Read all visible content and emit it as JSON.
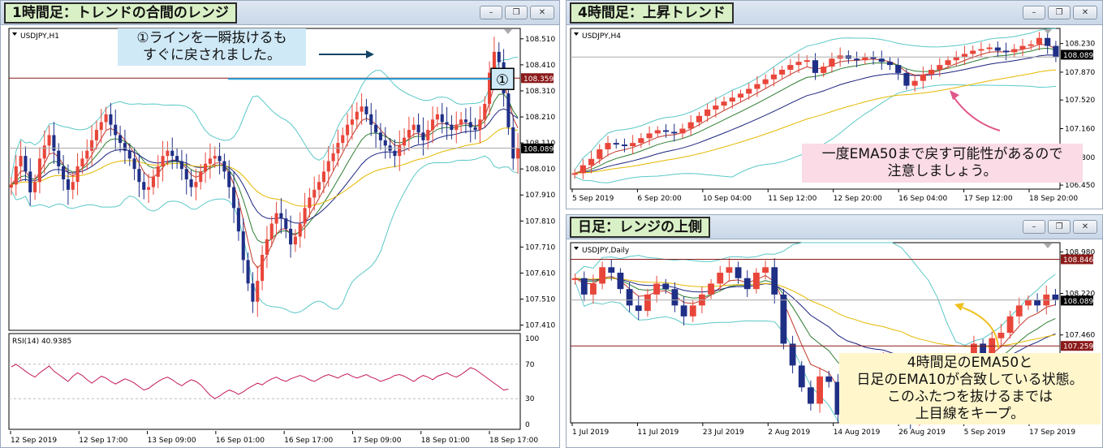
{
  "windows": {
    "h1": {
      "title": "1時間足：トレンドの合間のレンジ",
      "symbol_label": "USDJPY,H1",
      "price_levels": [
        "108.510",
        "108.410",
        "108.310",
        "108.210",
        "108.110",
        "108.010",
        "107.910",
        "107.810",
        "107.710",
        "107.610",
        "107.510",
        "107.410"
      ],
      "price_tags": [
        {
          "text": "108.359",
          "kind": "line"
        },
        {
          "text": "108.089",
          "kind": "current"
        }
      ],
      "marker": "①",
      "rsi_label": "RSI(14) 40.9385",
      "rsi_levels": [
        "100",
        "70",
        "30",
        "0"
      ],
      "time_labels": [
        "12 Sep 2019",
        "12 Sep 17:00",
        "13 Sep 09:00",
        "16 Sep 01:00",
        "16 Sep 17:00",
        "17 Sep 09:00",
        "18 Sep 01:00",
        "18 Sep 17:00"
      ],
      "annotation": [
        "①ラインを一瞬抜けるも",
        "すぐに戻されました。"
      ]
    },
    "h4": {
      "title": "4時間足：上昇トレンド",
      "symbol_label": "USDJPY,H4",
      "price_levels": [
        "108.230",
        "107.870",
        "107.520",
        "107.160",
        "106.800",
        "106.450"
      ],
      "price_tags": [
        {
          "text": "108.089",
          "kind": "current"
        }
      ],
      "time_labels": [
        "5 Sep 2019",
        "6 Sep 20:00",
        "10 Sep 04:00",
        "11 Sep 12:00",
        "12 Sep 20:00",
        "16 Sep 04:00",
        "17 Sep 12:00",
        "18 Sep 20:00"
      ],
      "annotation": [
        "一度EMA50まで戻す可能性があるので",
        "注意しましょう。"
      ]
    },
    "daily": {
      "title": "日足：レンジの上側",
      "symbol_label": "USDJPY,Daily",
      "price_levels": [
        "108.980",
        "108.220",
        "107.460",
        "106.680"
      ],
      "price_tags": [
        {
          "text": "108.846",
          "kind": "line"
        },
        {
          "text": "108.089",
          "kind": "current"
        },
        {
          "text": "107.259",
          "kind": "line"
        }
      ],
      "time_labels": [
        "1 Jul 2019",
        "11 Jul 2019",
        "23 Jul 2019",
        "2 Aug 2019",
        "14 Aug 2019",
        "26 Aug 2019",
        "5 Sep 2019",
        "17 Sep 2019"
      ],
      "annotation": [
        "4時間足のEMA50と",
        "日足のEMA10が合致している状態。",
        "このふたつを抜けるまでは",
        "上目線をキープ。"
      ]
    }
  },
  "window_buttons": {
    "minimize": "–",
    "restore": "❐",
    "close": "✕"
  },
  "colors": {
    "bull": "#e8463a",
    "bear": "#1f2f86",
    "bollinger": "#5cc8c8",
    "ema_fast": "#c0392b",
    "ema_mid": "#2e7d32",
    "ema_slow": "#1a237e",
    "ema_long": "#e6b800",
    "rsi": "#c2185b",
    "hline": "#8b1a1a",
    "cyan_line": "#27a9e1",
    "annotation_blue": "#cfe9f7",
    "annotation_pink": "#fadbe6",
    "annotation_yellow": "#fff6cc"
  },
  "chart_data": [
    {
      "type": "candlestick",
      "title": "1時間足：トレンドの合間のレンジ",
      "symbol": "USDJPY,H1",
      "ylim": [
        107.39,
        108.55
      ],
      "close_series": [
        107.95,
        108.02,
        108.06,
        108.0,
        107.92,
        107.96,
        108.05,
        108.1,
        108.14,
        108.08,
        108.02,
        107.97,
        107.93,
        107.96,
        108.02,
        108.05,
        108.08,
        108.12,
        108.16,
        108.19,
        108.22,
        108.18,
        108.14,
        108.11,
        108.08,
        108.05,
        108.01,
        107.96,
        107.93,
        107.94,
        107.98,
        108.02,
        108.06,
        108.08,
        108.06,
        108.04,
        108.01,
        107.97,
        107.94,
        107.96,
        108.0,
        108.03,
        108.05,
        108.06,
        108.04,
        108.0,
        107.94,
        107.86,
        107.77,
        107.66,
        107.57,
        107.5,
        107.58,
        107.68,
        107.74,
        107.8,
        107.84,
        107.82,
        107.78,
        107.72,
        107.75,
        107.8,
        107.86,
        107.9,
        107.93,
        107.96,
        108.0,
        108.04,
        108.07,
        108.11,
        108.14,
        108.18,
        108.2,
        108.23,
        108.25,
        108.22,
        108.18,
        108.15,
        108.12,
        108.1,
        108.08,
        108.06,
        108.1,
        108.13,
        108.16,
        108.18,
        108.15,
        108.12,
        108.16,
        108.2,
        108.22,
        108.19,
        108.18,
        108.16,
        108.18,
        108.2,
        108.19,
        108.17,
        108.16,
        108.2,
        108.26,
        108.38,
        108.46,
        108.42,
        108.3,
        108.17,
        108.05,
        108.09
      ],
      "rsi_series": [
        67,
        70,
        66,
        62,
        58,
        55,
        60,
        64,
        68,
        62,
        58,
        54,
        50,
        56,
        60,
        57,
        52,
        48,
        52,
        56,
        54,
        50,
        47,
        50,
        53,
        51,
        48,
        44,
        40,
        42,
        46,
        50,
        53,
        55,
        52,
        48,
        45,
        49,
        52,
        50,
        46,
        40,
        34,
        30,
        33,
        37,
        40,
        38,
        35,
        38,
        42,
        45,
        48,
        46,
        50,
        53,
        55,
        52,
        50,
        53,
        55,
        57,
        55,
        52,
        50,
        53,
        56,
        58,
        56,
        54,
        57,
        59,
        56,
        54,
        56,
        58,
        55,
        53,
        50,
        52,
        54,
        57,
        58,
        56,
        53,
        50,
        54,
        57,
        55,
        52,
        56,
        58,
        60,
        57,
        55,
        58,
        62,
        66,
        64,
        60,
        56,
        52,
        48,
        44,
        40,
        41
      ],
      "rsi_levels": [
        70,
        30
      ],
      "horizontal_lines": [
        108.359
      ]
    },
    {
      "type": "candlestick",
      "title": "4時間足：上昇トレンド",
      "symbol": "USDJPY,H4",
      "ylim": [
        106.4,
        108.42
      ],
      "close_series": [
        106.6,
        106.7,
        106.78,
        106.9,
        106.98,
        106.96,
        106.94,
        106.98,
        107.04,
        107.1,
        107.14,
        107.12,
        107.1,
        107.16,
        107.24,
        107.32,
        107.4,
        107.45,
        107.5,
        107.55,
        107.6,
        107.66,
        107.72,
        107.78,
        107.84,
        107.9,
        107.96,
        108.0,
        108.02,
        107.86,
        107.94,
        108.04,
        108.08,
        108.04,
        108.02,
        108.06,
        108.04,
        108.0,
        107.96,
        107.86,
        107.7,
        107.76,
        107.84,
        107.9,
        107.96,
        108.02,
        108.06,
        108.1,
        108.14,
        108.16,
        108.18,
        108.14,
        108.12,
        108.16,
        108.2,
        108.22,
        108.3,
        108.2,
        108.06
      ],
      "horizontal_lines": []
    },
    {
      "type": "candlestick",
      "title": "日足：レンジの上側",
      "symbol": "USDJPY,Daily",
      "ylim": [
        105.85,
        109.15
      ],
      "close_series": [
        108.5,
        108.2,
        108.4,
        108.7,
        108.6,
        108.3,
        108.0,
        107.9,
        108.2,
        108.4,
        108.3,
        108.0,
        107.8,
        108.0,
        108.2,
        108.4,
        108.6,
        108.7,
        108.5,
        108.3,
        108.6,
        108.7,
        108.2,
        107.3,
        106.9,
        106.5,
        106.2,
        106.7,
        106.6,
        106.0,
        106.4,
        106.8,
        106.6,
        106.9,
        107.0,
        106.6,
        106.7,
        105.9,
        106.3,
        106.6,
        106.5,
        106.8,
        106.9,
        107.0,
        107.3,
        107.0,
        107.4,
        107.5,
        107.8,
        108.0,
        108.1,
        108.0,
        108.2,
        108.1
      ],
      "horizontal_lines": [
        108.846,
        107.259
      ]
    }
  ]
}
